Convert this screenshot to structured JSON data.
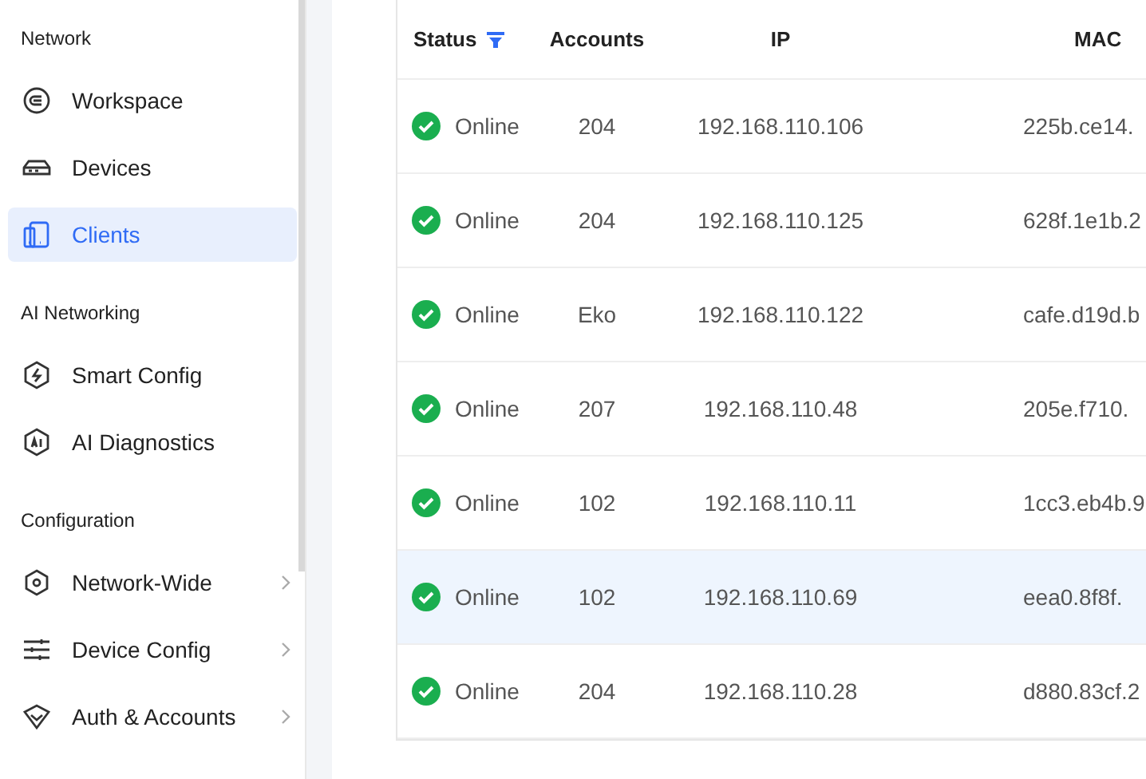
{
  "sidebar": {
    "sections": [
      {
        "title": "Network",
        "items": [
          {
            "label": "Workspace",
            "selected": false,
            "has_submenu": false
          },
          {
            "label": "Devices",
            "selected": false,
            "has_submenu": false
          },
          {
            "label": "Clients",
            "selected": true,
            "has_submenu": false
          }
        ]
      },
      {
        "title": "AI Networking",
        "items": [
          {
            "label": "Smart Config",
            "selected": false,
            "has_submenu": false
          },
          {
            "label": "AI Diagnostics",
            "selected": false,
            "has_submenu": false
          }
        ]
      },
      {
        "title": "Configuration",
        "items": [
          {
            "label": "Network-Wide",
            "selected": false,
            "has_submenu": true
          },
          {
            "label": "Device Config",
            "selected": false,
            "has_submenu": true
          },
          {
            "label": "Auth & Accounts",
            "selected": false,
            "has_submenu": true
          }
        ]
      }
    ]
  },
  "table": {
    "columns": [
      "Status",
      "Accounts",
      "IP",
      "MAC"
    ],
    "rows": [
      {
        "status": "Online",
        "kind": "online",
        "accounts": "204",
        "ip": "192.168.110.106",
        "mac": "225b.ce14.",
        "highlighted": false
      },
      {
        "status": "Online",
        "kind": "online",
        "accounts": "204",
        "ip": "192.168.110.125",
        "mac": "628f.1e1b.2",
        "highlighted": false
      },
      {
        "status": "Online",
        "kind": "online",
        "accounts": "Eko",
        "ip": "192.168.110.122",
        "mac": "cafe.d19d.b",
        "highlighted": false
      },
      {
        "status": "Online",
        "kind": "online",
        "accounts": "207",
        "ip": "192.168.110.48",
        "mac": "205e.f710.",
        "highlighted": false
      },
      {
        "status": "Online",
        "kind": "online",
        "accounts": "102",
        "ip": "192.168.110.11",
        "mac": "1cc3.eb4b.9",
        "highlighted": false
      },
      {
        "status": "Online",
        "kind": "online",
        "accounts": "102",
        "ip": "192.168.110.69",
        "mac": "eea0.8f8f.",
        "highlighted": true
      },
      {
        "status": "Online",
        "kind": "online",
        "accounts": "204",
        "ip": "192.168.110.28",
        "mac": "d880.83cf.2",
        "highlighted": false
      }
    ]
  }
}
